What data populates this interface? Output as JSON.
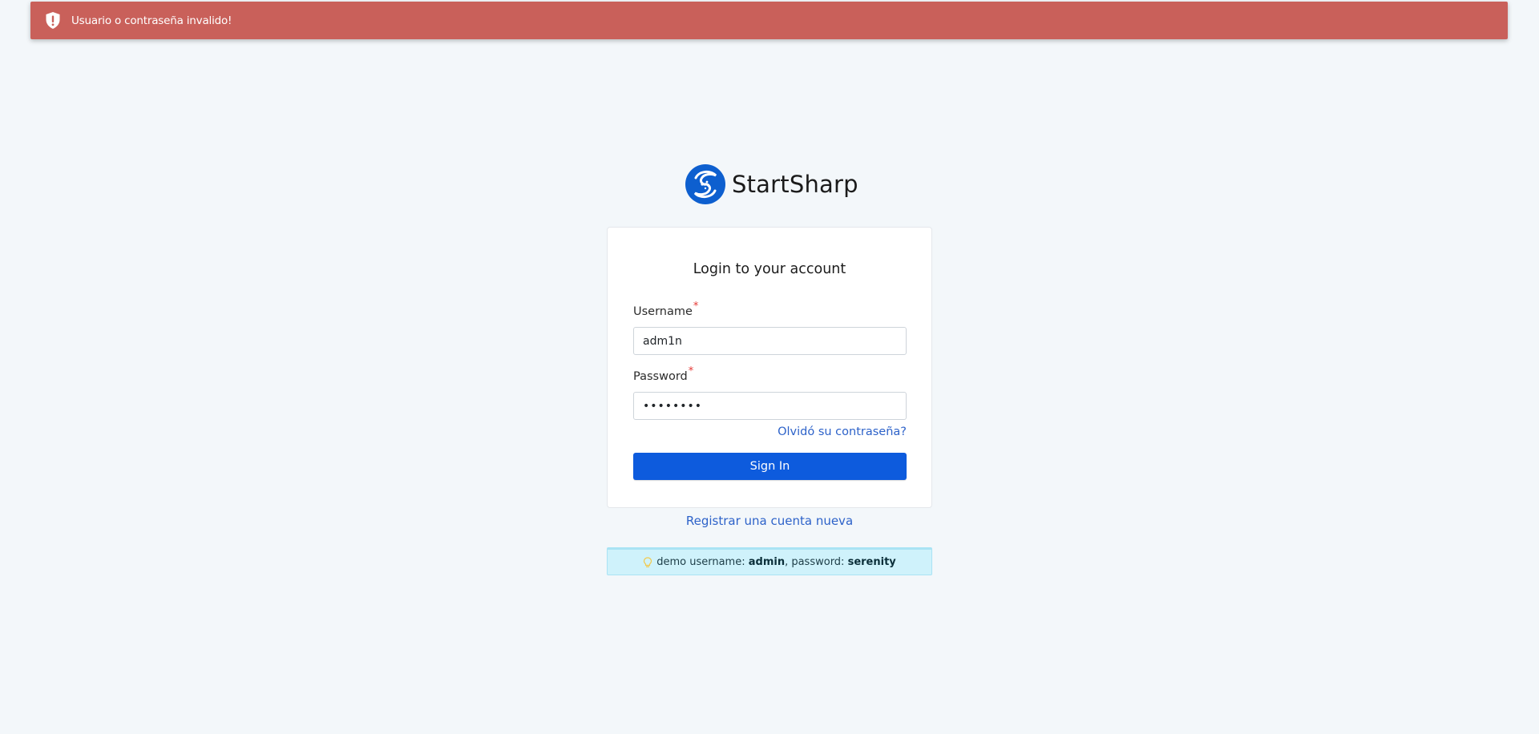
{
  "toast": {
    "message": "Usuario o contraseña invalido!",
    "background": "#c9605a",
    "icon": "shield-exclamation-icon"
  },
  "brand": {
    "name": "StartSharp",
    "logo_icon": "startsharp-logo-icon",
    "color": "#0d5bdd"
  },
  "login": {
    "title": "Login to your account",
    "username_label": "Username",
    "username_required": "*",
    "username_value": "adm1n",
    "password_label": "Password",
    "password_required": "*",
    "password_value": "••••••••",
    "forgot_link": "Olvidó su contraseña?",
    "signin_button": "Sign In"
  },
  "register_link": "Registrar una cuenta nueva",
  "demo_hint": {
    "icon": "lightbulb-icon",
    "prefix": "demo username: ",
    "username": "admin",
    "separator": ", password: ",
    "password": "serenity"
  }
}
